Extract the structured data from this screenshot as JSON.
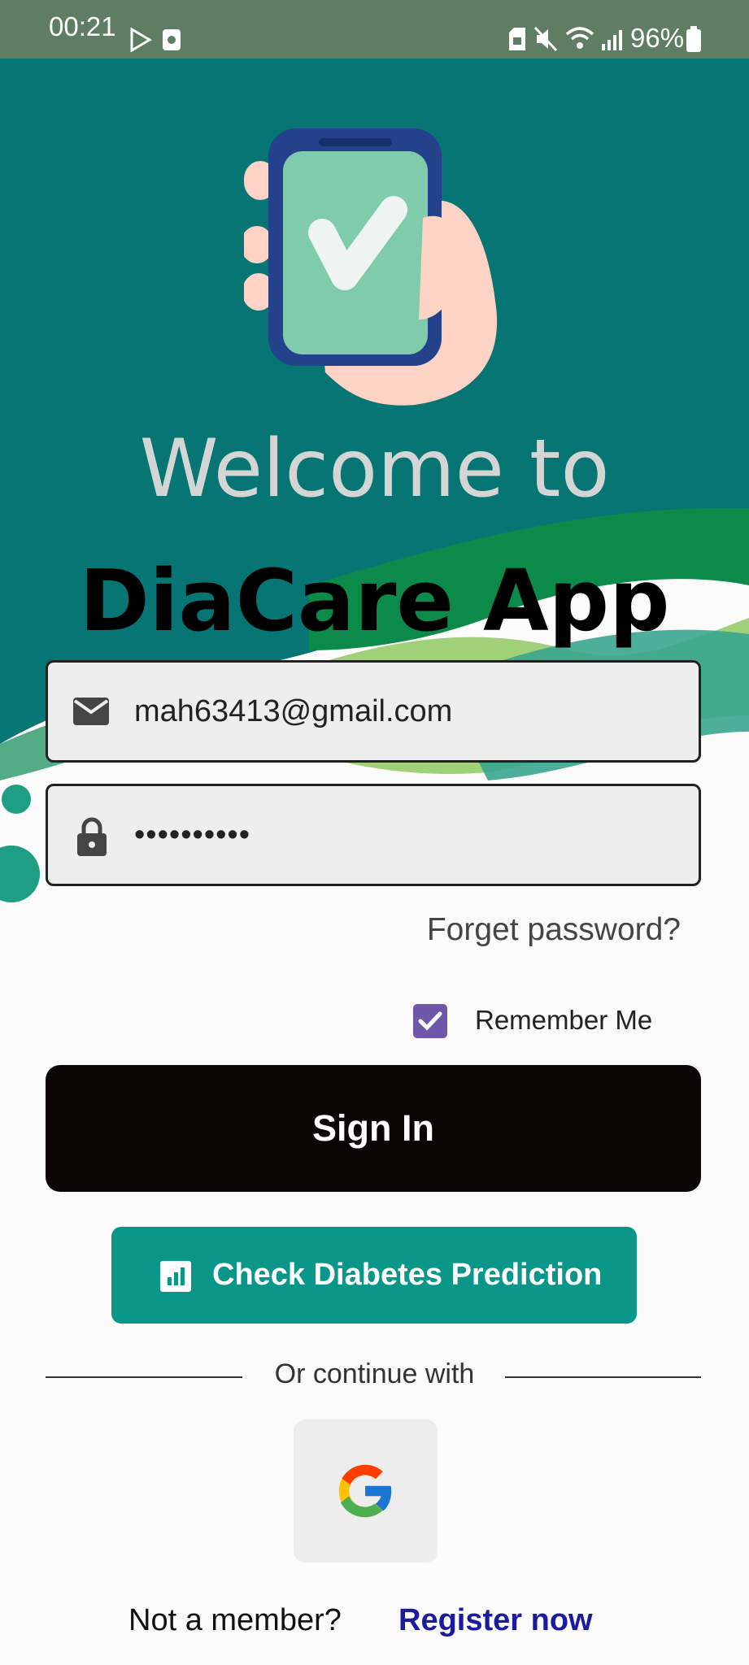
{
  "status_bar": {
    "time": "00:21",
    "battery": "96%",
    "icons_left": [
      "play-store-icon",
      "screen-record-icon"
    ],
    "icons_right": [
      "sim-lock-icon",
      "mute-icon",
      "wifi-icon",
      "signal-icon",
      "battery-icon"
    ]
  },
  "hero": {
    "illustration": "phone-check-icon",
    "welcome": "Welcome to",
    "app_name": "DiaCare App"
  },
  "login": {
    "email_value": "mah63413@gmail.com",
    "password_value": "••••••••••",
    "forget_password": "Forget password?",
    "remember_me": "Remember Me",
    "remember_checked": true,
    "sign_in": "Sign In",
    "prediction": "Check Diabetes Prediction"
  },
  "social": {
    "divider": "Or continue with",
    "google_icon": "google-icon"
  },
  "footer": {
    "question": "Not a member?",
    "register": "Register now"
  },
  "colors": {
    "teal_bg": "#077573",
    "accent_teal": "#0a9688",
    "checkbox": "#6e57a8",
    "link": "#1b1b9e"
  }
}
